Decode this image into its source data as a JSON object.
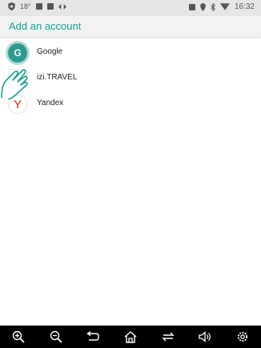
{
  "status_bar": {
    "temperature": "18°",
    "time": "16:32",
    "icons": [
      "shield-icon",
      "image-icon",
      "mail-icon",
      "sync-icon",
      "sim-icon",
      "location-icon",
      "bluetooth-icon",
      "wifi-icon"
    ]
  },
  "header": {
    "title": "Add an account"
  },
  "accounts": [
    {
      "label": "Google",
      "icon": "google-icon"
    },
    {
      "label": "izi.TRAVEL",
      "icon": "izi-travel-icon"
    },
    {
      "label": "Yandex",
      "icon": "yandex-icon"
    }
  ],
  "navbar": {
    "buttons": [
      "zoom-in-icon",
      "zoom-out-icon",
      "back-icon",
      "home-icon",
      "recents-icon",
      "volume-icon",
      "settings-icon"
    ]
  },
  "colors": {
    "accent": "#1aa391",
    "navbar": "#000000",
    "status_bar": "#e6e6e6"
  }
}
